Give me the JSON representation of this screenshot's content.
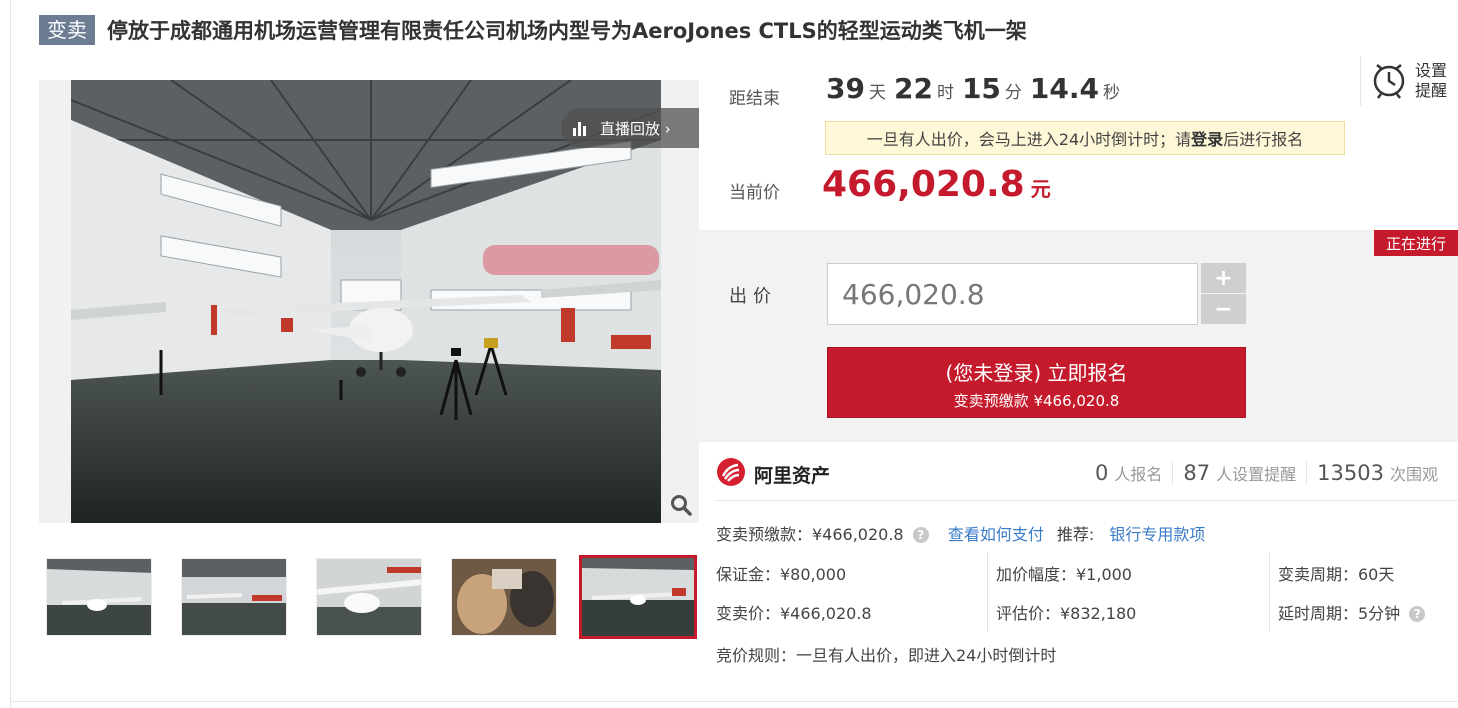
{
  "header": {
    "badge": "变卖",
    "title": "停放于成都通用机场运营管理有限责任公司机场内型号为AeroJones CTLS的轻型运动类飞机一架"
  },
  "gallery": {
    "replay_label": "直播回放 ›",
    "zoom_icon": "magnifier-icon",
    "thumb_count": 5,
    "active_thumb": 5
  },
  "countdown": {
    "label": "距结束",
    "days": "39",
    "days_unit": "天",
    "hours": "22",
    "hours_unit": "时",
    "minutes": "15",
    "minutes_unit": "分",
    "seconds": "14.4",
    "seconds_unit": "秒"
  },
  "reminder": {
    "line1": "设置",
    "line2": "提醒",
    "icon": "alarm-clock-icon"
  },
  "notice": {
    "text_before": "一旦有人出价，会马上进入24小时倒计时；请",
    "login": "登录",
    "text_after": "后进行报名"
  },
  "current_price": {
    "label": "当前价",
    "value": "466,020.8",
    "unit": "元"
  },
  "bid": {
    "status": "正在进行",
    "label": "出价",
    "input_value": "466,020.8",
    "plus": "+",
    "minus": "−",
    "button_line1": "(您未登录) 立即报名",
    "button_line2": "变卖预缴款 ¥466,020.8"
  },
  "brand": {
    "name": "阿里资产",
    "icon": "ali-assets-logo-icon"
  },
  "stats": [
    {
      "num": "0",
      "label": "人报名"
    },
    {
      "num": "87",
      "label": "人设置提醒"
    },
    {
      "num": "13503",
      "label": "次围观"
    }
  ],
  "info": {
    "prepay_label": "变卖预缴款：¥466,020.8",
    "how_to_pay": "查看如何支付",
    "recommend_label": "推荐:",
    "bank_link": "银行专用款项",
    "deposit": "保证金：¥80,000",
    "increment": "加价幅度：¥1,000",
    "period": "变卖周期：60天",
    "sale_price": "变卖价：¥466,020.8",
    "appraisal": "评估价：¥832,180",
    "delay": "延时周期：5分钟",
    "rule": "竞价规则：一旦有人出价，即进入24小时倒计时",
    "help_icon": "question-mark-icon"
  },
  "colors": {
    "accent": "#c41a2c",
    "badge": "#6b7c93",
    "link": "#3a7bc8",
    "notice_bg": "#fff8d8"
  }
}
